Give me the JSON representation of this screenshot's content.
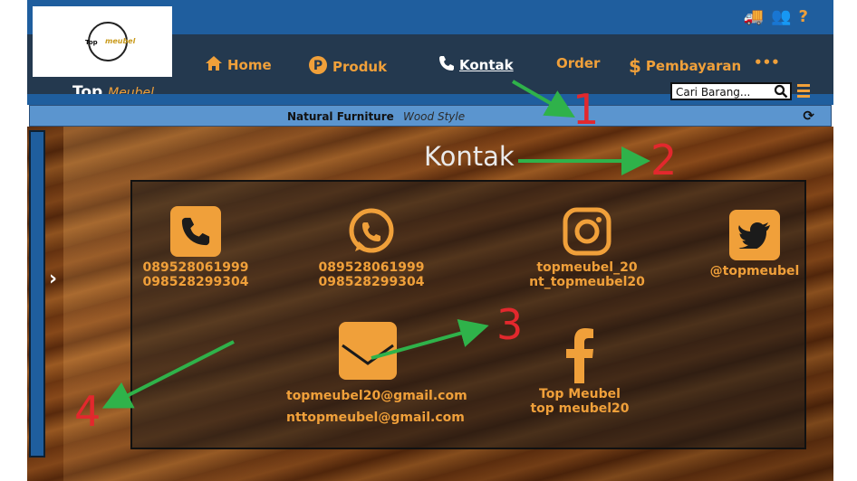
{
  "brand": {
    "name_bold": "Top",
    "name_italic": "Meubel",
    "logo_top": "Top",
    "logo_meubel": "meubel"
  },
  "header": {
    "icons": [
      "truck-icon",
      "users-icon",
      "help-icon"
    ],
    "nav": [
      {
        "label": "Home",
        "icon": "home-icon"
      },
      {
        "label": "Produk",
        "icon": "p-circle-icon"
      },
      {
        "label": "Kontak",
        "icon": "phone-icon",
        "active": true
      },
      {
        "label": "Order"
      },
      {
        "label": "Pembayaran",
        "icon": "dollar-icon"
      },
      {
        "label": "•••"
      }
    ],
    "search_placeholder": "Cari Barang..."
  },
  "tagbar": {
    "text": "Natural Furniture",
    "italic": "Wood Style"
  },
  "main": {
    "title": "Kontak",
    "contacts": {
      "phone": {
        "icon": "phone-icon",
        "line1": "089528061999",
        "line2": "098528299304"
      },
      "whatsapp": {
        "icon": "whatsapp-icon",
        "line1": "089528061999",
        "line2": "098528299304"
      },
      "instagram": {
        "icon": "instagram-icon",
        "line1": "topmeubel_20",
        "line2": "nt_topmeubel20"
      },
      "twitter": {
        "icon": "twitter-icon",
        "line1": "@topmeubel"
      },
      "email": {
        "icon": "envelope-icon",
        "line1": "topmeubel20@gmail.com",
        "line2": "nttopmeubel@gmail.com"
      },
      "facebook": {
        "icon": "facebook-icon",
        "line1": "Top Meubel",
        "line2": "top meubel20"
      }
    }
  },
  "annotations": [
    "1",
    "2",
    "3",
    "4"
  ],
  "colors": {
    "accent": "#f0a03a",
    "topbar": "#1f5e9e",
    "navbar": "#24394f",
    "arrow": "#2fb24a",
    "annotation": "#e2282d"
  }
}
